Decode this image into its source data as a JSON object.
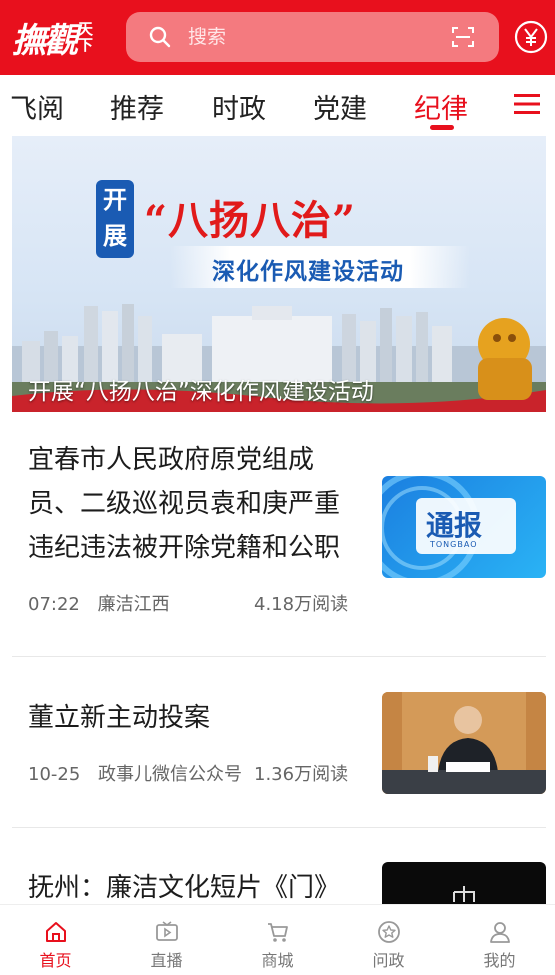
{
  "header": {
    "logo_main": "撫觀",
    "logo_side_top": "天",
    "logo_side_bottom": "下",
    "search_placeholder": "搜索",
    "icons": {
      "search": "search-icon",
      "scan": "scan-icon",
      "currency": "yuan-icon"
    }
  },
  "tabs": {
    "items": [
      {
        "label": "飞阅"
      },
      {
        "label": "推荐"
      },
      {
        "label": "时政"
      },
      {
        "label": "党建"
      },
      {
        "label": "纪律"
      }
    ],
    "active_index": 4,
    "menu_icon": "menu-icon"
  },
  "banner": {
    "tag": "开展",
    "headline": "“八扬八治”",
    "subheadline": "深化作风建设活动",
    "caption": "开展“八扬八治”深化作风建设活动"
  },
  "articles": [
    {
      "title": "宜春市人民政府原党组成员、二级巡视员袁和庚严重违纪违法被开除党籍和公职",
      "time": "07:22",
      "source": "廉洁江西",
      "reads": "4.18万阅读",
      "thumb_text": "通报",
      "thumb_sub": "TONGBAO"
    },
    {
      "title": "董立新主动投案",
      "time": "10-25",
      "source": "政事儿微信公众号",
      "reads": "1.36万阅读"
    },
    {
      "title": "抚州：廉洁文化短片《门》"
    }
  ],
  "bottom_nav": {
    "items": [
      {
        "label": "首页",
        "icon": "home-icon"
      },
      {
        "label": "直播",
        "icon": "live-icon"
      },
      {
        "label": "商城",
        "icon": "cart-icon"
      },
      {
        "label": "问政",
        "icon": "star-badge-icon"
      },
      {
        "label": "我的",
        "icon": "user-icon"
      }
    ],
    "active_index": 0
  },
  "colors": {
    "brand_red": "#e8101d",
    "search_bg": "#f47a7f",
    "text_dark": "#1c1c1c",
    "text_muted": "#666666"
  }
}
